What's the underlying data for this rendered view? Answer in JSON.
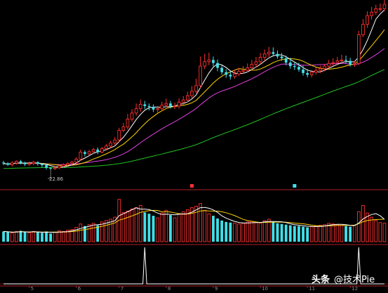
{
  "chart_data": {
    "type": "candlestick",
    "panels": [
      "price",
      "volume",
      "indicator"
    ],
    "colors": {
      "background": "#000000",
      "up": "#ff3030",
      "down": "#40e0e8",
      "divider": "#b0202a",
      "grid": "#7a1010",
      "ma5": "#ffffff",
      "ma10": "#ffd400",
      "ma20": "#e040e0",
      "ma60": "#20c020",
      "vol_ma5": "#ffffff",
      "vol_ma10": "#ffd400",
      "indicator": "#ffffff",
      "axis_text": "#8a8a8a",
      "marker_red": "#ff3030",
      "marker_cyan": "#40e0e8"
    },
    "price_range": [
      19,
      62
    ],
    "low_annotation": "22.86",
    "x_ticks": [
      "5",
      "6",
      "7",
      "8",
      "9",
      "10",
      "11",
      "12"
    ],
    "price": {
      "open": [
        24.6,
        24.4,
        24.1,
        24.5,
        24.9,
        24.6,
        24.2,
        24.4,
        24.7,
        24.3,
        24.0,
        23.4,
        23.2,
        23.4,
        23.8,
        24.1,
        24.4,
        24.7,
        25.4,
        27.0,
        26.6,
        27.1,
        27.6,
        27.0,
        27.8,
        28.4,
        29.1,
        29.8,
        32.0,
        32.8,
        34.6,
        36.0,
        37.0,
        38.0,
        37.6,
        37.4,
        36.8,
        37.0,
        37.8,
        38.2,
        37.6,
        37.6,
        38.5,
        39.0,
        40.0,
        41.0,
        42.3,
        46.8,
        47.8,
        48.2,
        47.5,
        46.4,
        45.4,
        44.8,
        44.4,
        45.0,
        45.6,
        45.8,
        46.4,
        47.2,
        47.8,
        48.8,
        49.6,
        50.0,
        49.6,
        49.0,
        48.6,
        47.6,
        46.8,
        46.6,
        46.0,
        45.2,
        44.8,
        45.4,
        45.8,
        46.2,
        46.8,
        47.4,
        47.6,
        48.0,
        48.2,
        48.0,
        47.2,
        47.4,
        54.0,
        56.4,
        58.4,
        59.2,
        60.0,
        60.0
      ],
      "close": [
        24.4,
        24.1,
        24.5,
        24.9,
        24.6,
        24.2,
        24.4,
        24.7,
        24.3,
        24.0,
        23.4,
        23.2,
        23.4,
        23.8,
        24.1,
        24.4,
        24.7,
        25.4,
        27.0,
        26.6,
        27.1,
        27.6,
        27.0,
        27.8,
        28.4,
        29.1,
        29.8,
        32.0,
        32.8,
        34.6,
        36.0,
        37.0,
        38.0,
        37.6,
        37.4,
        36.8,
        37.0,
        37.8,
        38.2,
        37.6,
        37.6,
        38.5,
        39.0,
        40.0,
        41.0,
        42.3,
        46.8,
        47.8,
        48.2,
        47.5,
        46.4,
        45.4,
        44.8,
        44.4,
        45.0,
        45.6,
        45.8,
        46.4,
        47.2,
        47.8,
        48.8,
        49.6,
        50.0,
        49.6,
        49.0,
        48.6,
        47.6,
        46.8,
        46.6,
        46.0,
        45.2,
        44.8,
        45.4,
        45.8,
        46.2,
        46.8,
        47.4,
        47.6,
        48.0,
        48.2,
        48.0,
        47.2,
        47.4,
        54.0,
        56.4,
        58.4,
        59.2,
        60.0,
        60.0,
        61.0
      ],
      "high": [
        25.0,
        24.7,
        24.9,
        25.1,
        25.2,
        24.8,
        24.8,
        25.0,
        24.9,
        24.5,
        24.3,
        23.6,
        23.8,
        24.1,
        24.4,
        24.7,
        25.0,
        25.8,
        27.6,
        27.4,
        27.5,
        28.0,
        28.1,
        28.2,
        28.9,
        29.6,
        30.5,
        32.6,
        33.7,
        35.8,
        36.9,
        38.2,
        39.1,
        38.8,
        38.2,
        38.0,
        37.6,
        38.6,
        39.3,
        38.8,
        38.4,
        39.4,
        39.9,
        40.9,
        42.2,
        43.9,
        49.0,
        49.6,
        49.9,
        49.0,
        48.3,
        46.9,
        46.1,
        45.6,
        45.9,
        46.4,
        46.8,
        47.4,
        48.2,
        48.9,
        49.8,
        50.6,
        51.2,
        51.1,
        50.4,
        49.8,
        49.2,
        48.7,
        47.6,
        47.6,
        46.9,
        46.1,
        45.9,
        46.5,
        46.9,
        47.3,
        48.2,
        48.6,
        48.9,
        49.4,
        49.2,
        48.7,
        48.0,
        54.9,
        57.6,
        59.4,
        60.4,
        60.9,
        61.2,
        62.0
      ],
      "low": [
        24.0,
        23.8,
        23.7,
        24.1,
        24.2,
        23.8,
        23.8,
        24.0,
        23.9,
        23.5,
        23.0,
        22.86,
        22.9,
        23.1,
        23.5,
        23.8,
        24.0,
        24.3,
        25.0,
        26.0,
        26.2,
        26.6,
        26.5,
        26.7,
        27.4,
        28.0,
        28.7,
        29.3,
        31.6,
        32.2,
        34.0,
        35.4,
        36.3,
        36.9,
        36.6,
        36.2,
        36.1,
        36.4,
        37.3,
        37.0,
        36.9,
        37.0,
        37.8,
        38.5,
        39.4,
        40.5,
        41.7,
        46.1,
        47.0,
        46.7,
        45.6,
        44.8,
        44.1,
        43.7,
        43.9,
        44.5,
        45.0,
        45.3,
        45.7,
        46.5,
        47.2,
        48.0,
        48.9,
        49.0,
        48.5,
        48.0,
        47.0,
        46.2,
        45.9,
        45.5,
        44.6,
        44.2,
        44.2,
        44.8,
        45.2,
        45.6,
        46.2,
        46.8,
        47.0,
        47.5,
        47.4,
        46.7,
        46.6,
        47.0,
        53.5,
        55.6,
        57.5,
        58.6,
        59.3,
        59.5
      ]
    },
    "volume_range": [
      0,
      7000
    ],
    "volume": [
      1500,
      1400,
      1300,
      1500,
      1600,
      1400,
      1300,
      1500,
      1400,
      1300,
      1500,
      1200,
      1400,
      1600,
      1500,
      1700,
      1800,
      2100,
      2600,
      2300,
      2500,
      2700,
      2400,
      2900,
      3100,
      3300,
      3600,
      6200,
      4300,
      4500,
      4800,
      5000,
      5300,
      4300,
      4100,
      3800,
      3500,
      4200,
      4600,
      3900,
      3500,
      4000,
      4400,
      4700,
      5000,
      5200,
      5600,
      4600,
      4100,
      3800,
      3400,
      3100,
      2900,
      2800,
      2700,
      2600,
      2700,
      2900,
      3000,
      2800,
      2700,
      3100,
      3300,
      2900,
      2700,
      2600,
      2500,
      2400,
      2300,
      2300,
      2200,
      2100,
      2200,
      2300,
      2400,
      2500,
      2700,
      2600,
      2500,
      2400,
      2300,
      2200,
      2400,
      4400,
      5300,
      4200,
      3600,
      3100,
      2800,
      2700
    ],
    "indicator_range": [
      0,
      100
    ],
    "indicator": [
      0,
      0,
      0,
      0,
      0,
      0,
      0,
      0,
      0,
      0,
      0,
      0,
      0,
      0,
      0,
      0,
      0,
      0,
      0,
      0,
      0,
      0,
      0,
      0,
      0,
      0,
      0,
      0,
      0,
      0,
      0,
      0,
      0,
      0,
      0,
      0,
      0,
      0,
      0,
      0,
      0,
      0,
      0,
      0,
      0,
      0,
      0,
      0,
      0,
      0,
      0,
      0,
      0,
      0,
      0,
      0,
      0,
      0,
      0,
      0,
      0,
      0,
      0,
      0,
      0,
      0,
      0,
      0,
      0,
      0,
      0,
      0,
      0,
      0,
      0,
      0,
      0,
      0,
      0,
      0,
      0,
      0,
      0,
      0,
      0,
      0,
      0,
      0,
      0,
      0
    ],
    "indicator_spikes": [
      {
        "index": 33,
        "value": 100
      },
      {
        "index": 83,
        "value": 100
      }
    ],
    "markers": [
      {
        "index": 44,
        "color": "red"
      },
      {
        "index": 68,
        "color": "cyan"
      }
    ]
  },
  "watermark": {
    "brand": "头条",
    "handle": "@技术Pie"
  }
}
